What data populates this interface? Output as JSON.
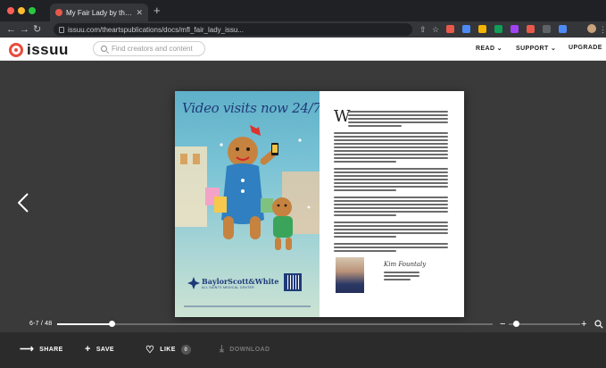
{
  "browser": {
    "tab_title": "My Fair Lady by theartspublications - issuu",
    "tab_close": "✕",
    "new_tab": "+",
    "url": "issuu.com/theartspublications/docs/mfl_fair_lady_issu...",
    "traffic_colors": [
      "#ff5f57",
      "#febc2e",
      "#28c840"
    ],
    "extension_colors": [
      "#e8594b",
      "#4c8bf5",
      "#f4b400",
      "#0f9d58",
      "#a142f4",
      "#e8594b",
      "#5f6368",
      "#4c8bf5"
    ]
  },
  "site": {
    "logo_text": "issuu",
    "search_placeholder": "Find creators and content",
    "nav": {
      "read": "READ",
      "support": "SUPPORT",
      "upgrade": "UPGRADE"
    },
    "brand_color": "#e84b3c"
  },
  "reader": {
    "ad_headline": "Video visits now 24/7.",
    "ad_brand": "BaylorScott&White",
    "ad_brand_sub": "ALL SAINTS MEDICAL CENTER",
    "letter_dropcap": "W",
    "signature": "Kim Fountaly",
    "page_count": "6-7 / 48",
    "progress_fraction": 0.125,
    "zoom_fraction": 0.1
  },
  "actions": {
    "share": "SHARE",
    "save": "SAVE",
    "like": "LIKE",
    "like_count": "0",
    "download": "DOWNLOAD"
  }
}
